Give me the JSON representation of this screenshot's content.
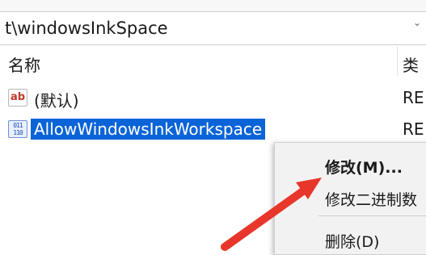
{
  "address_bar": {
    "path": "t\\windowsInkSpace",
    "dropdown_glyph": "⌄"
  },
  "columns": {
    "name": "名称",
    "type": "类"
  },
  "rows": [
    {
      "icon": "string-value-icon",
      "icon_text": "ab",
      "name": "(默认)",
      "type": "RE"
    },
    {
      "icon": "binary-value-icon",
      "icon_text": "011 110",
      "name": "AllowWindowsInkWorkspace",
      "type": "RE",
      "selected": true
    }
  ],
  "context_menu": {
    "items": [
      {
        "label": "修改(M)...",
        "bold": true
      },
      {
        "label": "修改二进制数"
      },
      {
        "label": "删除(D)"
      }
    ]
  },
  "colors": {
    "selection": "#0a64d8",
    "arrow": "#e8362a",
    "menu_bg": "#f2f2f2"
  }
}
